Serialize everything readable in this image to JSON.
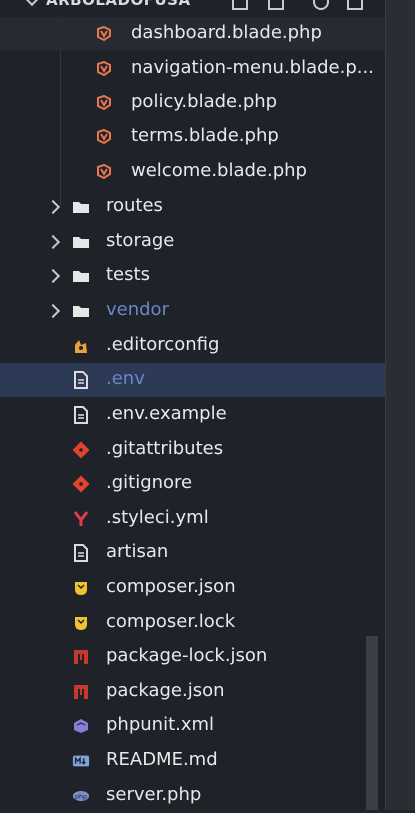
{
  "explorer": {
    "title": "ARBOLADOFUSA",
    "items": [
      {
        "label": "dashboard.blade.php",
        "icon": "laravel-blade-icon"
      },
      {
        "label": "navigation-menu.blade.p...",
        "icon": "laravel-blade-icon"
      },
      {
        "label": "policy.blade.php",
        "icon": "laravel-blade-icon"
      },
      {
        "label": "terms.blade.php",
        "icon": "laravel-blade-icon"
      },
      {
        "label": "welcome.blade.php",
        "icon": "laravel-blade-icon"
      },
      {
        "label": "routes",
        "icon": "folder-icon"
      },
      {
        "label": "storage",
        "icon": "folder-icon"
      },
      {
        "label": "tests",
        "icon": "folder-icon"
      },
      {
        "label": "vendor",
        "icon": "folder-icon"
      },
      {
        "label": ".editorconfig",
        "icon": "editorconfig-icon"
      },
      {
        "label": ".env",
        "icon": "text-file-icon"
      },
      {
        "label": ".env.example",
        "icon": "text-file-icon"
      },
      {
        "label": ".gitattributes",
        "icon": "git-icon"
      },
      {
        "label": ".gitignore",
        "icon": "git-icon"
      },
      {
        "label": ".styleci.yml",
        "icon": "yaml-icon"
      },
      {
        "label": "artisan",
        "icon": "text-file-icon"
      },
      {
        "label": "composer.json",
        "icon": "composer-icon"
      },
      {
        "label": "composer.lock",
        "icon": "composer-icon"
      },
      {
        "label": "package-lock.json",
        "icon": "npm-icon"
      },
      {
        "label": "package.json",
        "icon": "npm-icon"
      },
      {
        "label": "phpunit.xml",
        "icon": "phpunit-icon"
      },
      {
        "label": "README.md",
        "icon": "markdown-icon"
      },
      {
        "label": "server.php",
        "icon": "php-icon"
      }
    ]
  },
  "colors": {
    "background": "#1f2228",
    "selected": "#2c3a55",
    "blade": "#e8774d",
    "git": "#e0452c",
    "composer": "#f1c232",
    "npm": "#c5382a",
    "dim_text": "#6b86c9"
  }
}
